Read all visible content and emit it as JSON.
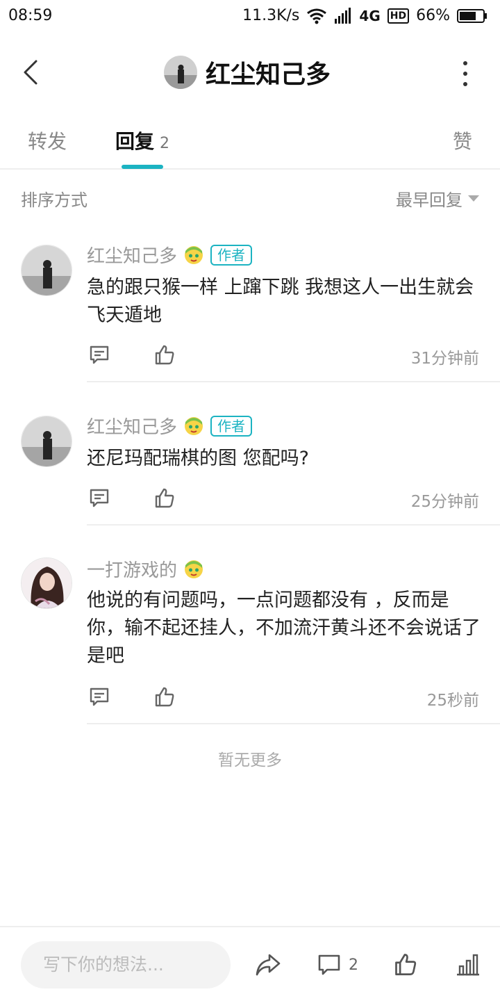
{
  "status_bar": {
    "time": "08:59",
    "speed": "11.3K/s",
    "network": "4G",
    "hd": "HD",
    "battery": "66%"
  },
  "header": {
    "title": "红尘知己多"
  },
  "tabs": [
    {
      "label": "转发",
      "active": false
    },
    {
      "label": "回复",
      "count": "2",
      "active": true
    },
    {
      "label": "赞",
      "active": false
    }
  ],
  "sort": {
    "label": "排序方式",
    "value": "最早回复"
  },
  "comments": [
    {
      "name": "红尘知己多",
      "badge": "作者",
      "text": "急的跟只猴一样 上蹿下跳 我想这人一出生就会飞天遁地",
      "time": "31分钟前"
    },
    {
      "name": "红尘知己多",
      "badge": "作者",
      "text": "还尼玛配瑞棋的图 您配吗?",
      "time": "25分钟前"
    },
    {
      "name": "一打游戏的",
      "text": "他说的有问题吗，一点问题都没有 ，反而是你，输不起还挂人，不加流汗黄斗还不会说话了是吧",
      "time": "25秒前"
    }
  ],
  "no_more": "暂无更多",
  "bottom_bar": {
    "placeholder": "写下你的想法...",
    "comment_count": "2"
  },
  "colors": {
    "accent": "#1bb3c2",
    "muted_text": "#999999",
    "divider": "#eeeeee"
  }
}
